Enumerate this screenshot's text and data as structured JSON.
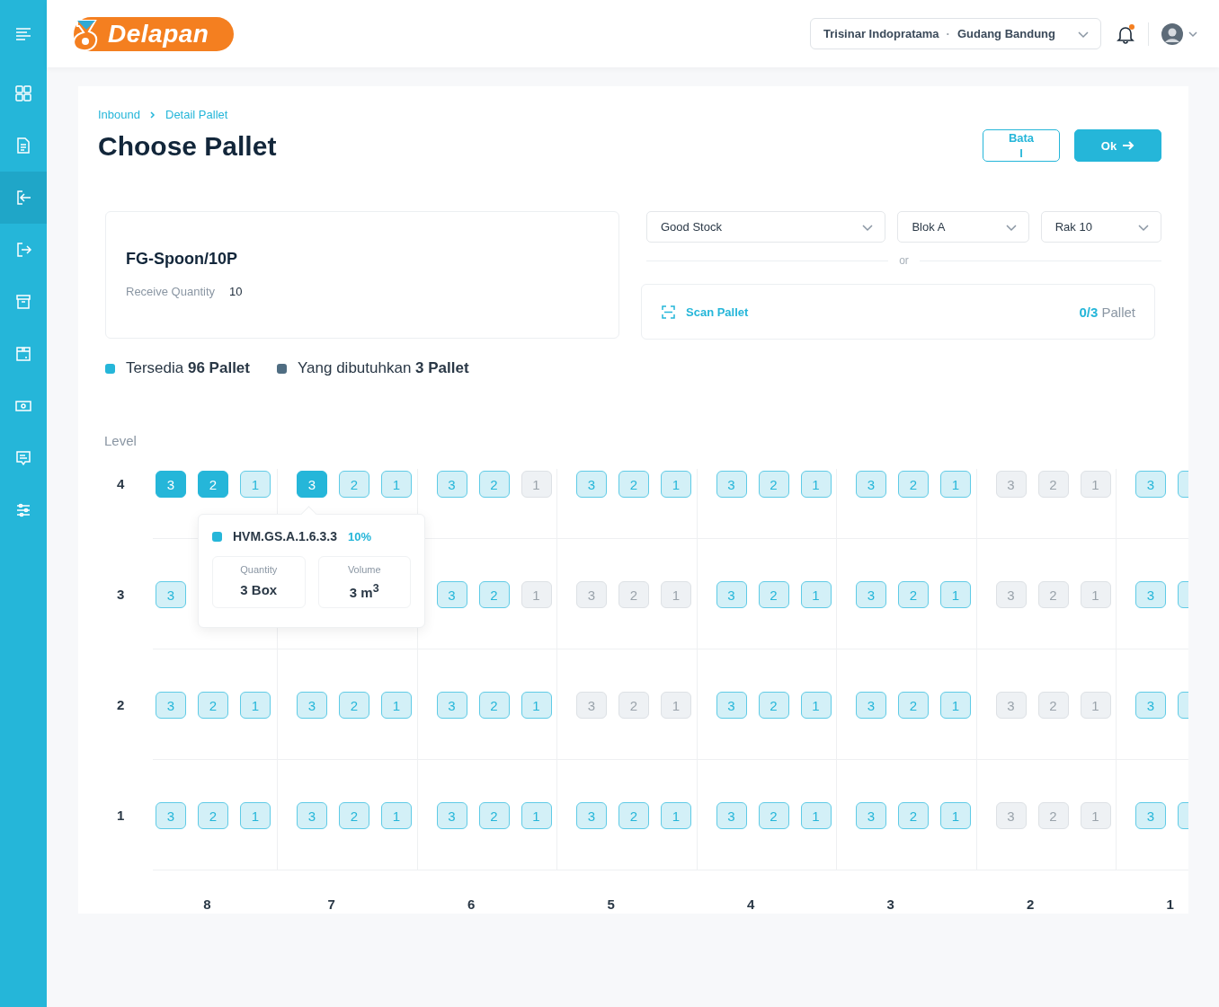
{
  "sidebar": {
    "items": [
      {
        "kind": "menu",
        "selected": false
      },
      {
        "kind": "dashboard",
        "selected": false
      },
      {
        "kind": "document",
        "selected": false
      },
      {
        "kind": "inbound",
        "selected": true
      },
      {
        "kind": "outbound",
        "selected": false
      },
      {
        "kind": "archive",
        "selected": false
      },
      {
        "kind": "box",
        "selected": false
      },
      {
        "kind": "money",
        "selected": false
      },
      {
        "kind": "message",
        "selected": false
      },
      {
        "kind": "settings",
        "selected": false
      }
    ]
  },
  "header": {
    "logo": "Delapan",
    "company": "Trisinar Indopratama",
    "separator": "·",
    "warehouse": "Gudang Bandung",
    "notification": true
  },
  "breadcrumb": [
    "Inbound",
    "Detail Pallet"
  ],
  "title": "Choose Pallet",
  "buttons": [
    {
      "label": "Batal",
      "kind": "outline"
    },
    {
      "label": "Ok",
      "kind": "primary"
    }
  ],
  "product": {
    "name": "FG-Spoon/10P",
    "quantity_label": "Receive Quantity",
    "quantity": "10"
  },
  "filters": [
    {
      "value": "Good Stock"
    },
    {
      "value": "Blok A"
    },
    {
      "value": "Rak 10"
    }
  ],
  "divider_text": "or",
  "scan": {
    "label": "Scan Pallet",
    "count": "0/3",
    "unit": "Pallet"
  },
  "legend": [
    {
      "text": "Tersedia **96 Pallet**",
      "color": "#25b6d9"
    },
    {
      "text": "Yang dibutuhkan **3 Pallet**",
      "color": "#4f6d82"
    }
  ],
  "grid": {
    "axis_label": "Level",
    "columns": [
      "8",
      "7",
      "6",
      "5",
      "4",
      "3",
      "2",
      "1"
    ],
    "levels": [
      {
        "label": "4",
        "cells": [
          {
            "slots": [
              {
                "label": "3",
                "selected": true,
                "available": true
              },
              {
                "label": "2",
                "selected": true,
                "available": true
              },
              {
                "label": "1",
                "selected": false,
                "available": true
              }
            ]
          },
          {
            "slots": [
              {
                "label": "3",
                "selected": true,
                "available": true
              },
              {
                "label": "2",
                "selected": false,
                "available": true
              },
              {
                "label": "1",
                "selected": false,
                "available": true
              }
            ]
          },
          {
            "slots": [
              {
                "label": "3",
                "selected": false,
                "available": true
              },
              {
                "label": "2",
                "selected": false,
                "available": true
              },
              {
                "label": "1",
                "selected": false,
                "available": false
              }
            ]
          },
          {
            "slots": [
              {
                "label": "3",
                "selected": false,
                "available": true
              },
              {
                "label": "2",
                "selected": false,
                "available": true
              },
              {
                "label": "1",
                "selected": false,
                "available": true
              }
            ]
          },
          {
            "slots": [
              {
                "label": "3",
                "selected": false,
                "available": true
              },
              {
                "label": "2",
                "selected": false,
                "available": true
              },
              {
                "label": "1",
                "selected": false,
                "available": true
              }
            ]
          },
          {
            "slots": [
              {
                "label": "3",
                "selected": false,
                "available": true
              },
              {
                "label": "2",
                "selected": false,
                "available": true
              },
              {
                "label": "1",
                "selected": false,
                "available": true
              }
            ]
          },
          {
            "slots": [
              {
                "label": "3",
                "selected": false,
                "available": false
              },
              {
                "label": "2",
                "selected": false,
                "available": false
              },
              {
                "label": "1",
                "selected": false,
                "available": false
              }
            ]
          },
          {
            "slots": [
              {
                "label": "3",
                "selected": false,
                "available": true
              },
              {
                "selected": false,
                "available": true
              }
            ]
          }
        ]
      },
      {
        "label": "3",
        "cells": [
          {
            "slots": [
              {
                "label": "3",
                "selected": false,
                "available": true
              }
            ]
          },
          {},
          {
            "slots": [
              {
                "label": "3",
                "selected": false,
                "available": true
              },
              {
                "label": "2",
                "selected": false,
                "available": true
              },
              {
                "label": "1",
                "selected": false,
                "available": false
              }
            ]
          },
          {
            "slots": [
              {
                "label": "3",
                "selected": false,
                "available": false
              },
              {
                "label": "2",
                "selected": false,
                "available": false
              },
              {
                "label": "1",
                "selected": false,
                "available": false
              }
            ]
          },
          {
            "slots": [
              {
                "label": "3",
                "selected": false,
                "available": true
              },
              {
                "label": "2",
                "selected": false,
                "available": true
              },
              {
                "label": "1",
                "selected": false,
                "available": true
              }
            ]
          },
          {
            "slots": [
              {
                "label": "3",
                "selected": false,
                "available": true
              },
              {
                "label": "2",
                "selected": false,
                "available": true
              },
              {
                "label": "1",
                "selected": false,
                "available": true
              }
            ]
          },
          {
            "slots": [
              {
                "label": "3",
                "selected": false,
                "available": false
              },
              {
                "label": "2",
                "selected": false,
                "available": false
              },
              {
                "label": "1",
                "selected": false,
                "available": false
              }
            ]
          },
          {
            "slots": [
              {
                "label": "3",
                "selected": false,
                "available": true
              },
              {
                "selected": false,
                "available": true
              }
            ]
          }
        ]
      },
      {
        "label": "2",
        "cells": [
          {
            "slots": [
              {
                "label": "3",
                "selected": false,
                "available": true
              },
              {
                "label": "2",
                "selected": false,
                "available": true
              },
              {
                "label": "1",
                "selected": false,
                "available": true
              }
            ]
          },
          {
            "slots": [
              {
                "label": "3",
                "selected": false,
                "available": true
              },
              {
                "label": "2",
                "selected": false,
                "available": true
              },
              {
                "label": "1",
                "selected": false,
                "available": true
              }
            ]
          },
          {
            "slots": [
              {
                "label": "3",
                "selected": false,
                "available": true
              },
              {
                "label": "2",
                "selected": false,
                "available": true
              },
              {
                "label": "1",
                "selected": false,
                "available": true
              }
            ]
          },
          {
            "slots": [
              {
                "label": "3",
                "selected": false,
                "available": false
              },
              {
                "label": "2",
                "selected": false,
                "available": false
              },
              {
                "label": "1",
                "selected": false,
                "available": false
              }
            ]
          },
          {
            "slots": [
              {
                "label": "3",
                "selected": false,
                "available": true
              },
              {
                "label": "2",
                "selected": false,
                "available": true
              },
              {
                "label": "1",
                "selected": false,
                "available": true
              }
            ]
          },
          {
            "slots": [
              {
                "label": "3",
                "selected": false,
                "available": true
              },
              {
                "label": "2",
                "selected": false,
                "available": true
              },
              {
                "label": "1",
                "selected": false,
                "available": true
              }
            ]
          },
          {
            "slots": [
              {
                "label": "3",
                "selected": false,
                "available": false
              },
              {
                "label": "2",
                "selected": false,
                "available": false
              },
              {
                "label": "1",
                "selected": false,
                "available": false
              }
            ]
          },
          {
            "slots": [
              {
                "label": "3",
                "selected": false,
                "available": true
              },
              {
                "selected": false,
                "available": true
              }
            ]
          }
        ]
      },
      {
        "label": "1",
        "cells": [
          {
            "slots": [
              {
                "label": "3",
                "selected": false,
                "available": true
              },
              {
                "label": "2",
                "selected": false,
                "available": true
              },
              {
                "label": "1",
                "selected": false,
                "available": true
              }
            ]
          },
          {
            "slots": [
              {
                "label": "3",
                "selected": false,
                "available": true
              },
              {
                "label": "2",
                "selected": false,
                "available": true
              },
              {
                "label": "1",
                "selected": false,
                "available": true
              }
            ]
          },
          {
            "slots": [
              {
                "label": "3",
                "selected": false,
                "available": true
              },
              {
                "label": "2",
                "selected": false,
                "available": true
              },
              {
                "label": "1",
                "selected": false,
                "available": true
              }
            ]
          },
          {
            "slots": [
              {
                "label": "3",
                "selected": false,
                "available": true
              },
              {
                "label": "2",
                "selected": false,
                "available": true
              },
              {
                "label": "1",
                "selected": false,
                "available": true
              }
            ]
          },
          {
            "slots": [
              {
                "label": "3",
                "selected": false,
                "available": true
              },
              {
                "label": "2",
                "selected": false,
                "available": true
              },
              {
                "label": "1",
                "selected": false,
                "available": true
              }
            ]
          },
          {
            "slots": [
              {
                "label": "3",
                "selected": false,
                "available": true
              },
              {
                "label": "2",
                "selected": false,
                "available": true
              },
              {
                "label": "1",
                "selected": false,
                "available": true
              }
            ]
          },
          {
            "slots": [
              {
                "label": "3",
                "selected": false,
                "available": false
              },
              {
                "label": "2",
                "selected": false,
                "available": false
              },
              {
                "label": "1",
                "selected": false,
                "available": false
              }
            ]
          },
          {
            "slots": [
              {
                "label": "3",
                "selected": false,
                "available": true
              },
              {
                "selected": false,
                "available": true
              }
            ]
          }
        ]
      }
    ]
  },
  "tooltip": {
    "color": "#25b6d9",
    "code": "HVM.GS.A.1.6.3.3",
    "percent": "10%",
    "stats": [
      {
        "label": "Quantity",
        "value": "3 Box"
      },
      {
        "label": "Volume",
        "value": "3 m$^{3}$"
      }
    ]
  }
}
